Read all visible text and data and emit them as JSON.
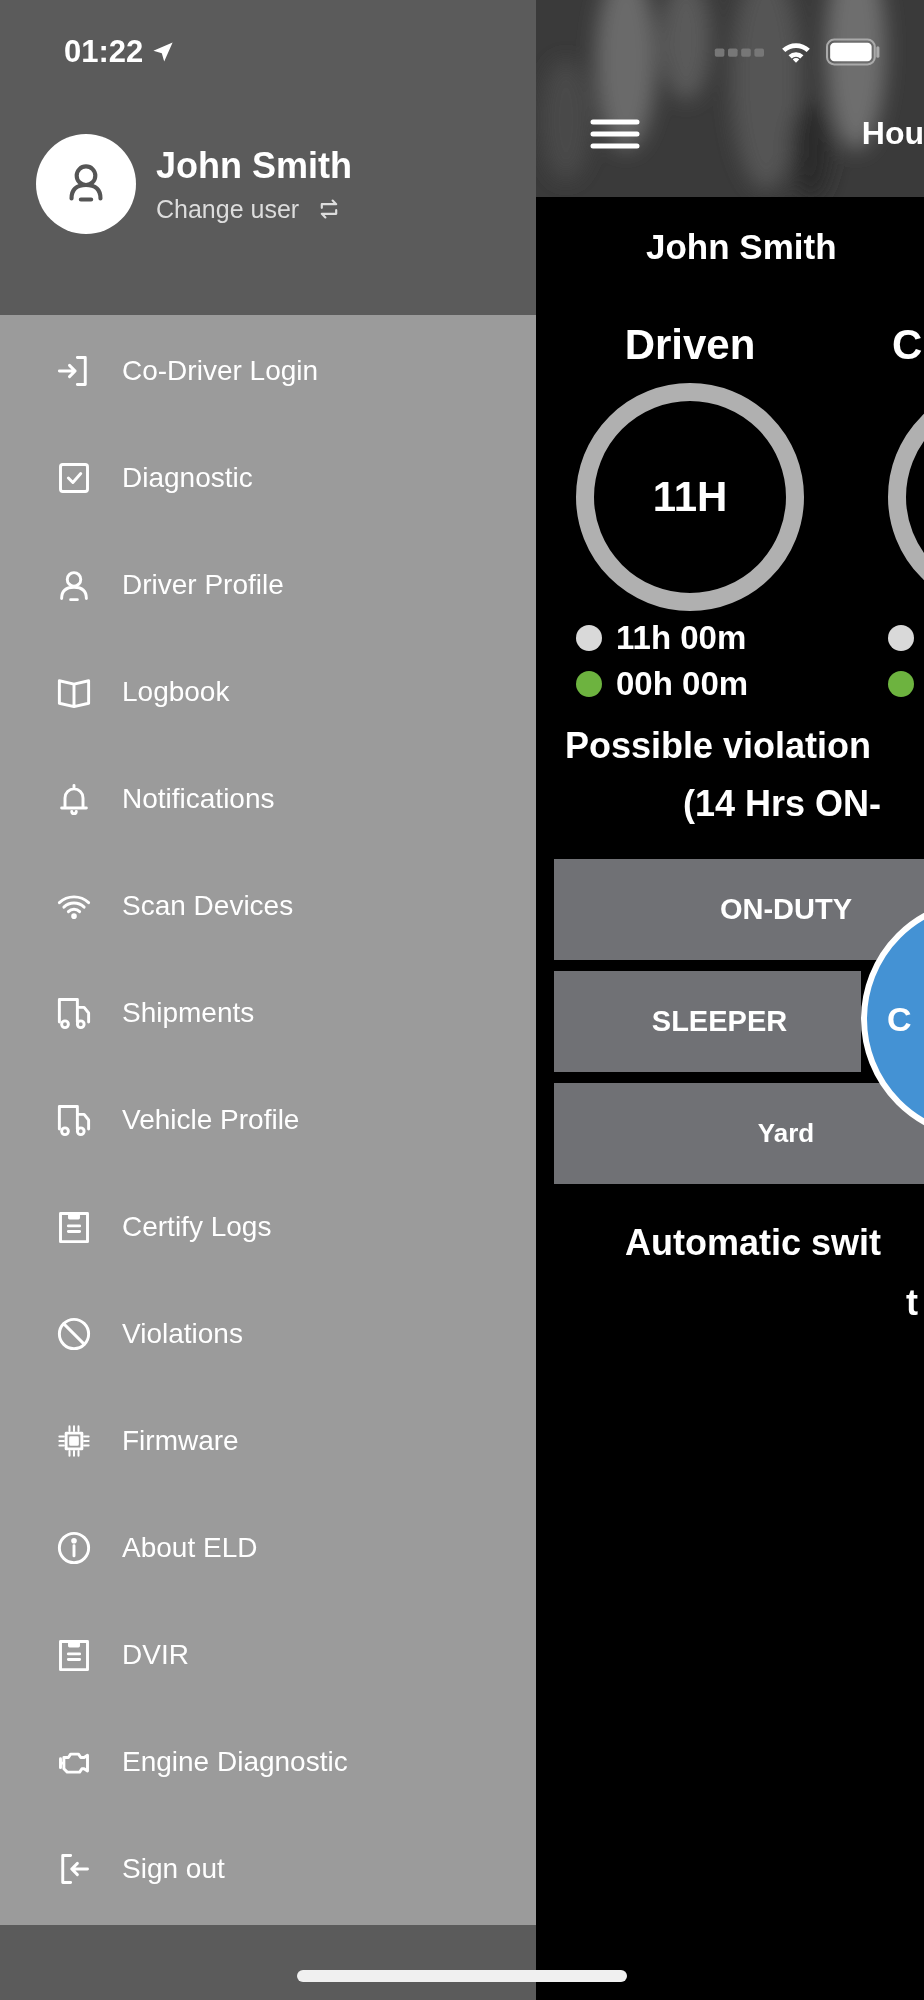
{
  "status_bar": {
    "time": "01:22"
  },
  "drawer": {
    "user": {
      "name": "John Smith",
      "change_label": "Change user"
    },
    "items": [
      {
        "label": "Co-Driver Login",
        "kind": "signin"
      },
      {
        "label": "Diagnostic",
        "kind": "check"
      },
      {
        "label": "Driver Profile",
        "kind": "person"
      },
      {
        "label": "Logbook",
        "kind": "book"
      },
      {
        "label": "Notifications",
        "kind": "bell"
      },
      {
        "label": "Scan Devices",
        "kind": "wifi"
      },
      {
        "label": "Shipments",
        "kind": "truck"
      },
      {
        "label": "Vehicle Profile",
        "kind": "truck"
      },
      {
        "label": "Certify Logs",
        "kind": "clipboard"
      },
      {
        "label": "Violations",
        "kind": "ban"
      },
      {
        "label": "Firmware",
        "kind": "chip"
      },
      {
        "label": "About ELD",
        "kind": "info"
      },
      {
        "label": "DVIR",
        "kind": "clipboard"
      },
      {
        "label": "Engine Diagnostic",
        "kind": "engine"
      },
      {
        "label": "Sign out",
        "kind": "signout"
      }
    ]
  },
  "main": {
    "title": "Hou",
    "driver": "John Smith",
    "gauges": [
      {
        "heading": "Driven",
        "value": "11H",
        "legend": [
          {
            "text": "11h 00m",
            "color": "#d9d9d9"
          },
          {
            "text": "00h 00m",
            "color": "#6db33f"
          }
        ]
      },
      {
        "heading": "C",
        "legend": [
          {
            "color": "#d9d9d9"
          },
          {
            "color": "#6db33f"
          }
        ]
      }
    ],
    "warning": [
      "Possible violation",
      "(14 Hrs ON-"
    ],
    "status_buttons": [
      {
        "label": "ON-DUTY"
      },
      {
        "label": "SLEEPER"
      },
      {
        "label": "Yard"
      }
    ],
    "current_status": {
      "label": "C"
    },
    "auto_switch": [
      "Automatic swit",
      "t"
    ]
  }
}
